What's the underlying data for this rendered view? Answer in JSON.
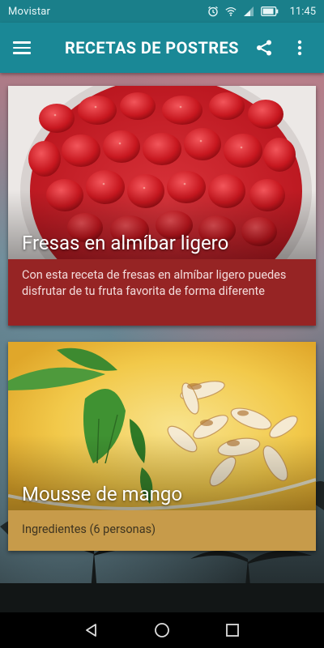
{
  "status_bar": {
    "carrier": "Movistar",
    "time": "11:45",
    "icons": [
      "alarm-icon",
      "wifi-icon",
      "signal-icon",
      "battery-icon"
    ]
  },
  "toolbar": {
    "title": "RECETAS DE POSTRES",
    "actions": [
      "menu-icon",
      "share-icon",
      "more-vert-icon"
    ]
  },
  "recipes": [
    {
      "title": "Fresas en almíbar ligero",
      "description": "Con esta receta de fresas en almíbar ligero puedes disfrutar de tu fruta favorita de forma diferente",
      "caption_color": "#962424"
    },
    {
      "title": "Mousse de mango",
      "description": "Ingredientes (6 personas)",
      "caption_color": "#c79b4a"
    }
  ],
  "nav_bar": {
    "buttons": [
      "back-icon",
      "home-icon",
      "recents-icon"
    ]
  },
  "colors": {
    "status_bar": "#1a7f8a",
    "toolbar": "#1a8896"
  }
}
